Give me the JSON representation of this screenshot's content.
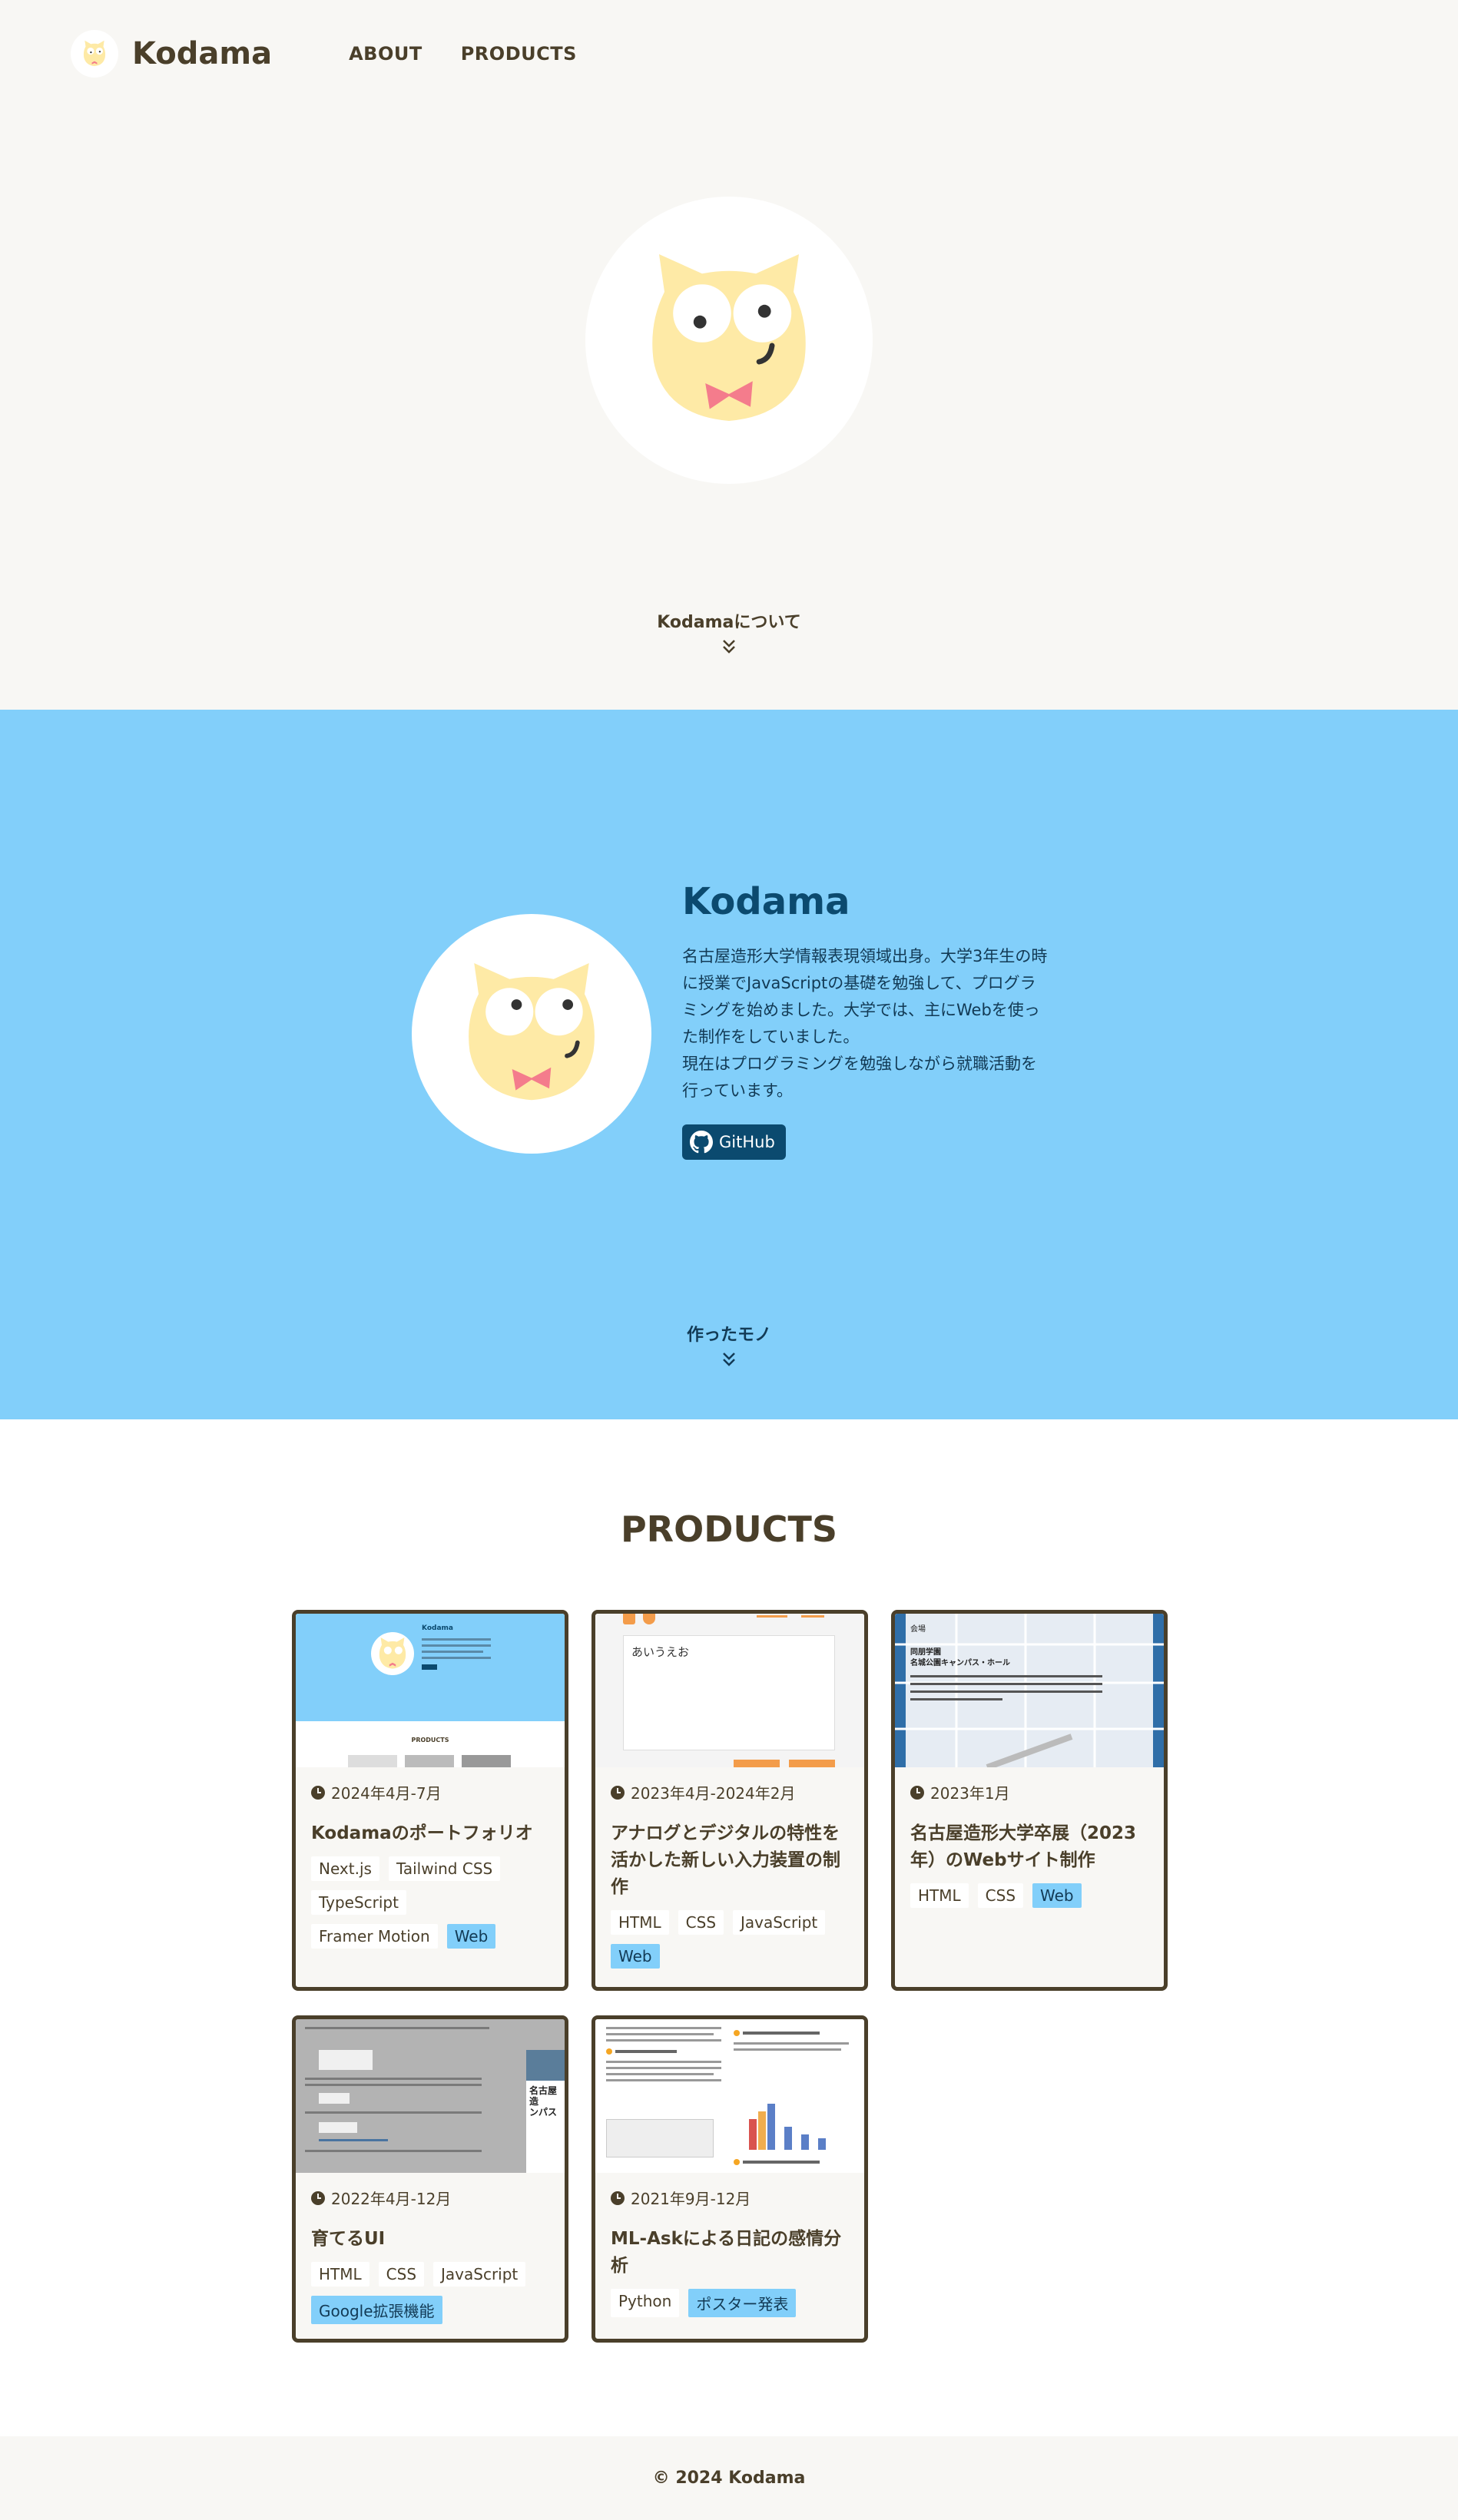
{
  "header": {
    "logo_text": "Kodama",
    "nav": [
      "ABOUT",
      "PRODUCTS"
    ]
  },
  "hero": {
    "scroll_label": "Kodamaについて"
  },
  "about": {
    "name": "Kodama",
    "bio": "名古屋造形大学情報表現領域出身。大学3年生の時に授業でJavaScriptの基礎を勉強して、プログラミングを始めました。大学では、主にWebを使った制作をしていました。\n現在はプログラミングを勉強しながら就職活動を行っています。",
    "github_label": "GitHub",
    "scroll_label": "作ったモノ"
  },
  "products": {
    "title": "PRODUCTS",
    "cards": [
      {
        "date": "2024年4月-7月",
        "title": "Kodamaのポートフォリオ",
        "tags": [
          "Next.js",
          "Tailwind CSS",
          "TypeScript",
          "Framer Motion"
        ],
        "highlight_tag": "Web",
        "thumb_text": [
          "Kodama",
          "PRODUCTS"
        ]
      },
      {
        "date": "2023年4月-2024年2月",
        "title": "アナログとデジタルの特性を活かした新しい入力装置の制作",
        "tags": [
          "HTML",
          "CSS",
          "JavaScript"
        ],
        "highlight_tag": "Web",
        "thumb_text": [
          "あいうえお"
        ]
      },
      {
        "date": "2023年1月",
        "title": "名古屋造形大学卒展（2023年）のWebサイト制作",
        "tags": [
          "HTML",
          "CSS"
        ],
        "highlight_tag": "Web",
        "thumb_text": [
          "会場",
          "同朋学園",
          "名城公園キャンパス・ホール"
        ]
      },
      {
        "date": "2022年4月-12月",
        "title": "育てるUI",
        "tags": [
          "HTML",
          "CSS",
          "JavaScript"
        ],
        "highlight_tag": "Google拡張機能",
        "thumb_text": [
          "名古屋造",
          "ンパス"
        ]
      },
      {
        "date": "2021年9月-12月",
        "title": "ML-Askによる日記の感情分析",
        "tags": [
          "Python"
        ],
        "highlight_tag": "ポスター発表",
        "thumb_text": []
      }
    ]
  },
  "footer": {
    "copyright": "© 2024 Kodama"
  },
  "colors": {
    "text": "#4a3f2a",
    "background": "#f8f7f4",
    "about_bg": "#82cffa",
    "dark_blue": "#0b4a6f",
    "owl_body": "#feeaa6",
    "bowtie": "#f47c8c"
  }
}
